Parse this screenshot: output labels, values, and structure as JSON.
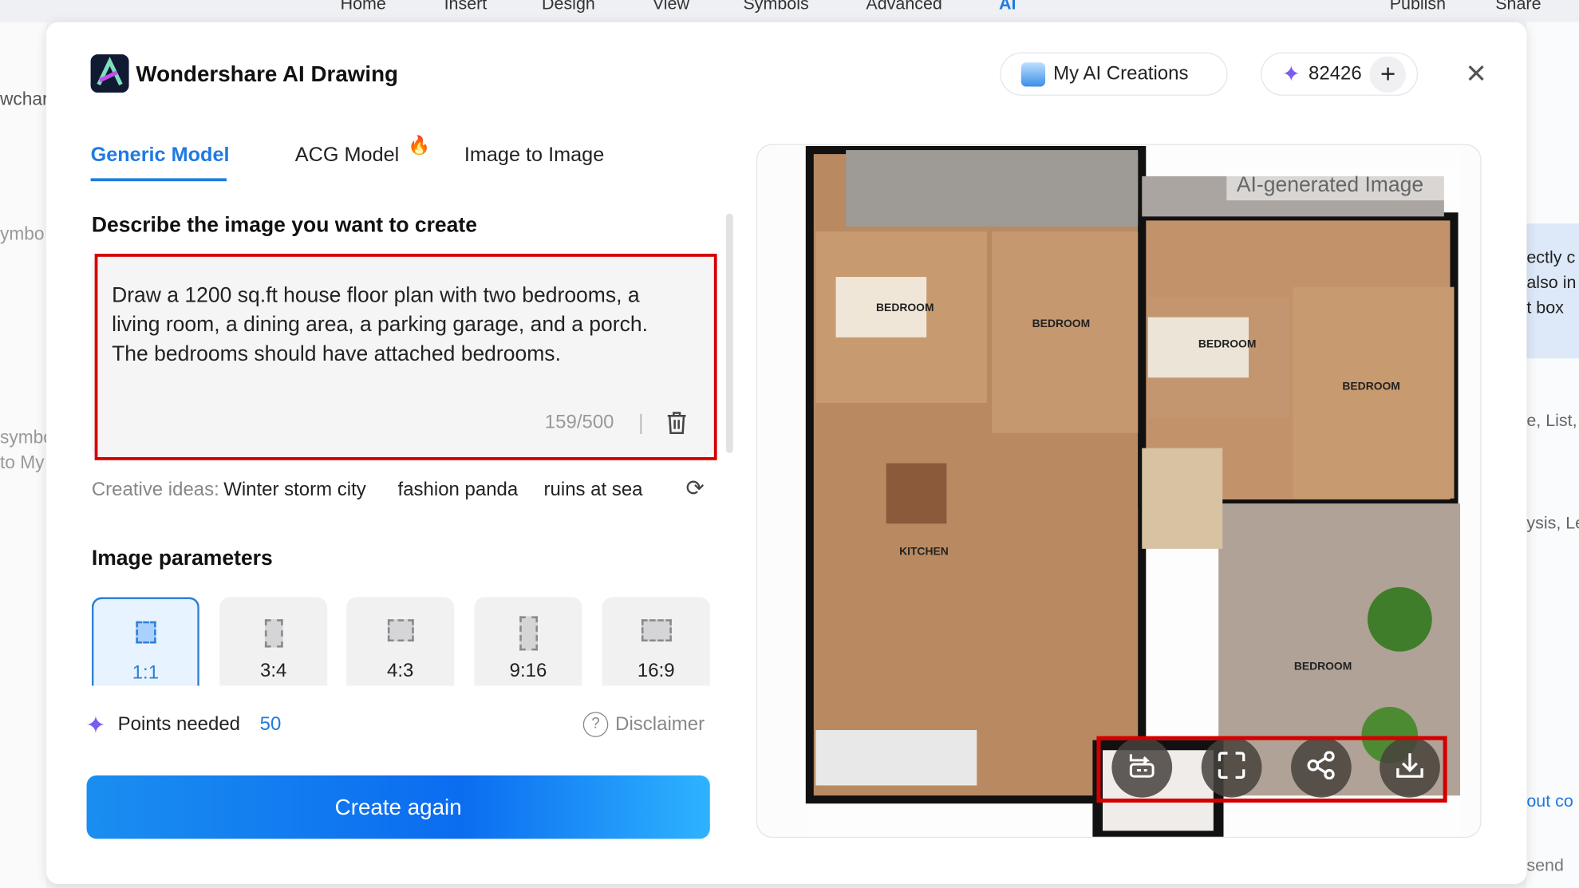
{
  "menu": {
    "items": [
      "Home",
      "Insert",
      "Design",
      "View",
      "Symbols",
      "Advanced",
      "AI"
    ],
    "active": "AI",
    "publish": "Publish",
    "share": "Share"
  },
  "background": {
    "left": [
      "wchar",
      "ymbo",
      "symbo",
      "to My"
    ],
    "right": [
      "ectly c",
      "also in",
      "t box",
      "e, List,",
      "ysis, Lea",
      "out co",
      "send"
    ]
  },
  "header": {
    "title": "Wondershare AI Drawing",
    "my_creations": "My AI Creations",
    "points": "82426"
  },
  "tabs": [
    {
      "label": "Generic Model",
      "active": true
    },
    {
      "label": "ACG Model"
    },
    {
      "label": "Image to Image"
    }
  ],
  "prompt": {
    "heading": "Describe the image you want to create",
    "text": "Draw a 1200 sq.ft house floor plan with two bedrooms, a living room, a dining area, a parking garage, and a porch. The bedrooms should have attached bedrooms.",
    "counter": "159/500"
  },
  "ideas": {
    "label": "Creative ideas:",
    "items": [
      "Winter storm city",
      "fashion panda",
      "ruins at sea"
    ]
  },
  "params": {
    "heading": "Image parameters",
    "ratios": [
      "1:1",
      "3:4",
      "4:3",
      "9:16",
      "16:9"
    ],
    "selected": "1:1"
  },
  "points_needed": {
    "label": "Points needed",
    "value": "50"
  },
  "disclaimer": "Disclaimer",
  "create_button": "Create again",
  "image": {
    "watermark": "AI-generated Image",
    "room_labels": [
      "BEDROOM",
      "BEDROOM",
      "BEDROOM",
      "BEDROOM",
      "KITCHEN",
      "BEDROOM"
    ]
  },
  "colors": {
    "accent": "#1f7ae0",
    "highlight": "#d40000"
  }
}
